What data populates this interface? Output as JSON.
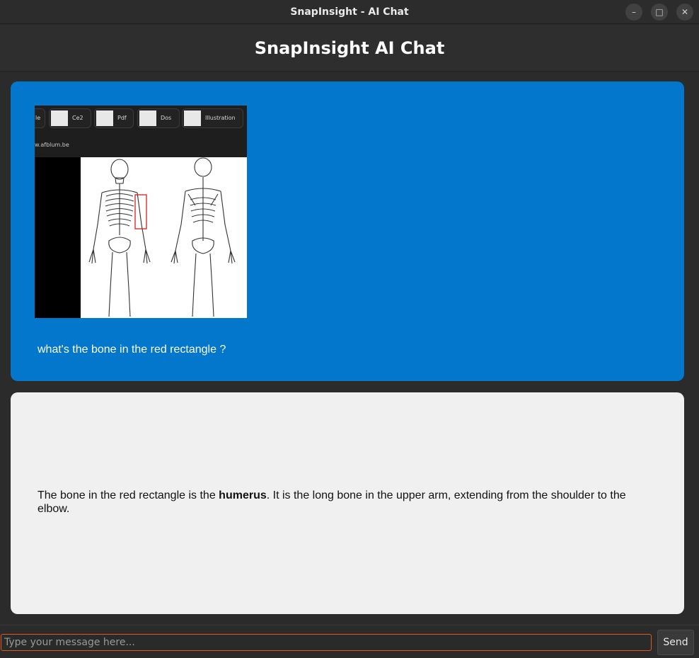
{
  "window": {
    "title": "SnapInsight - AI Chat",
    "controls": [
      "minimize-icon",
      "maximize-icon",
      "close-icon"
    ]
  },
  "header": {
    "title": "SnapInsight AI Chat"
  },
  "chat": {
    "user_message": {
      "screenshot": {
        "tabs": [
          "le",
          "Ce2",
          "Pdf",
          "Dos",
          "Illustration"
        ],
        "url_fragment": "w.afblum.be"
      },
      "text": "what's the bone in the red rectangle ?"
    },
    "assistant_message": {
      "text_before": "The bone in the red rectangle is the ",
      "bold": "humerus",
      "text_after": ". It is the long bone in the upper arm, extending from the shoulder to the elbow."
    }
  },
  "input": {
    "placeholder": "Type your message here...",
    "value": ""
  },
  "send_button": {
    "label": "Send"
  },
  "colors": {
    "user_bubble": "#0277cc",
    "assistant_bubble": "#f0f0f0",
    "input_focus_border": "#e05a1e",
    "highlight_rectangle": "#d42020"
  }
}
